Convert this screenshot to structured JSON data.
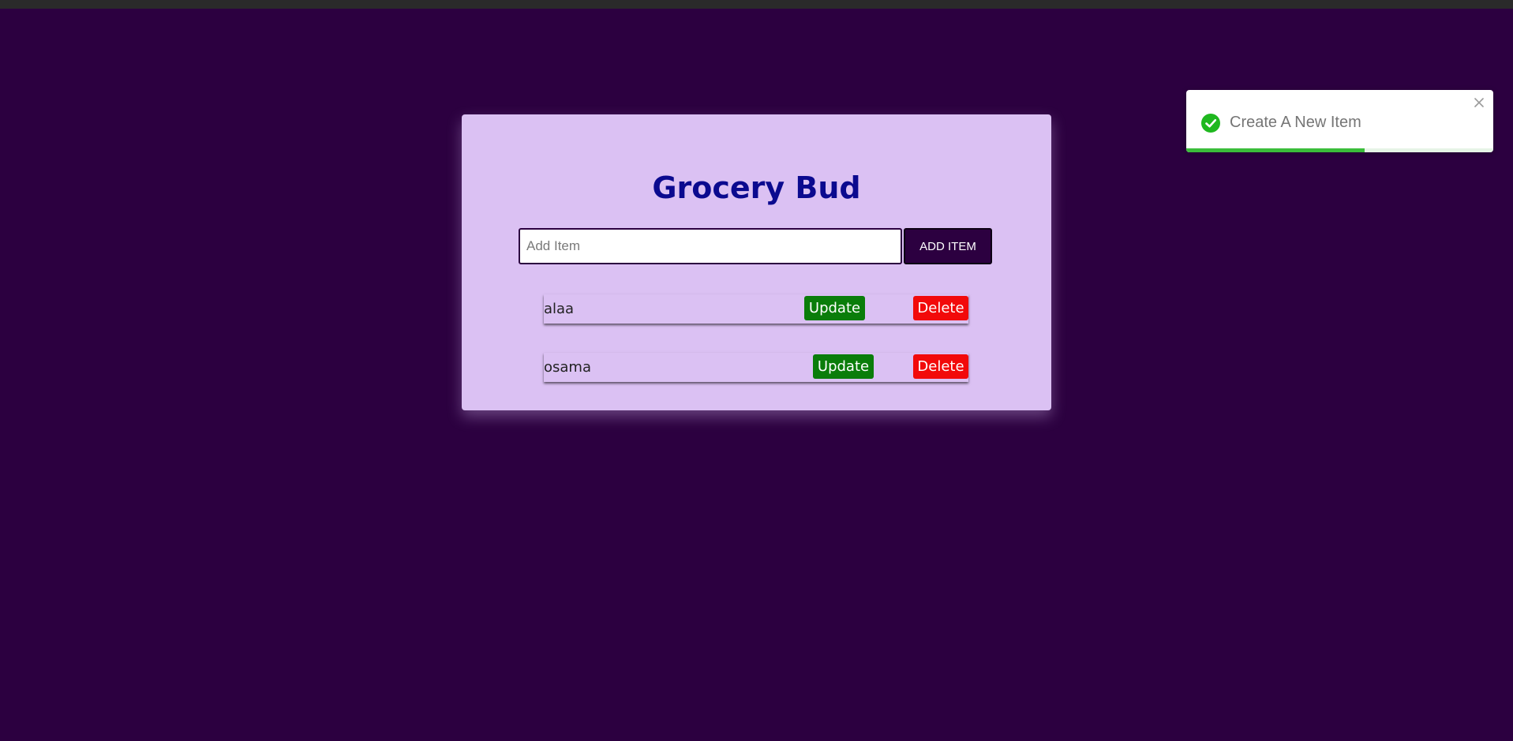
{
  "app": {
    "title": "Grocery Bud"
  },
  "form": {
    "input_value": "",
    "placeholder": "Add Item",
    "add_button_label": "ADD ITEM"
  },
  "items": [
    {
      "name": "alaa",
      "update_label": "Update",
      "delete_label": "Delete"
    },
    {
      "name": "osama",
      "update_label": "Update",
      "delete_label": "Delete"
    }
  ],
  "toast": {
    "message": "Create A New Item",
    "status": "success",
    "progress": 0.58,
    "icon": "check-circle-icon"
  },
  "colors": {
    "background": "#2c0040",
    "card": "#dbc1f3",
    "title": "#0b0a8f",
    "update": "#0a7d0a",
    "delete": "#f20a0a",
    "success": "#3bbd3b"
  }
}
